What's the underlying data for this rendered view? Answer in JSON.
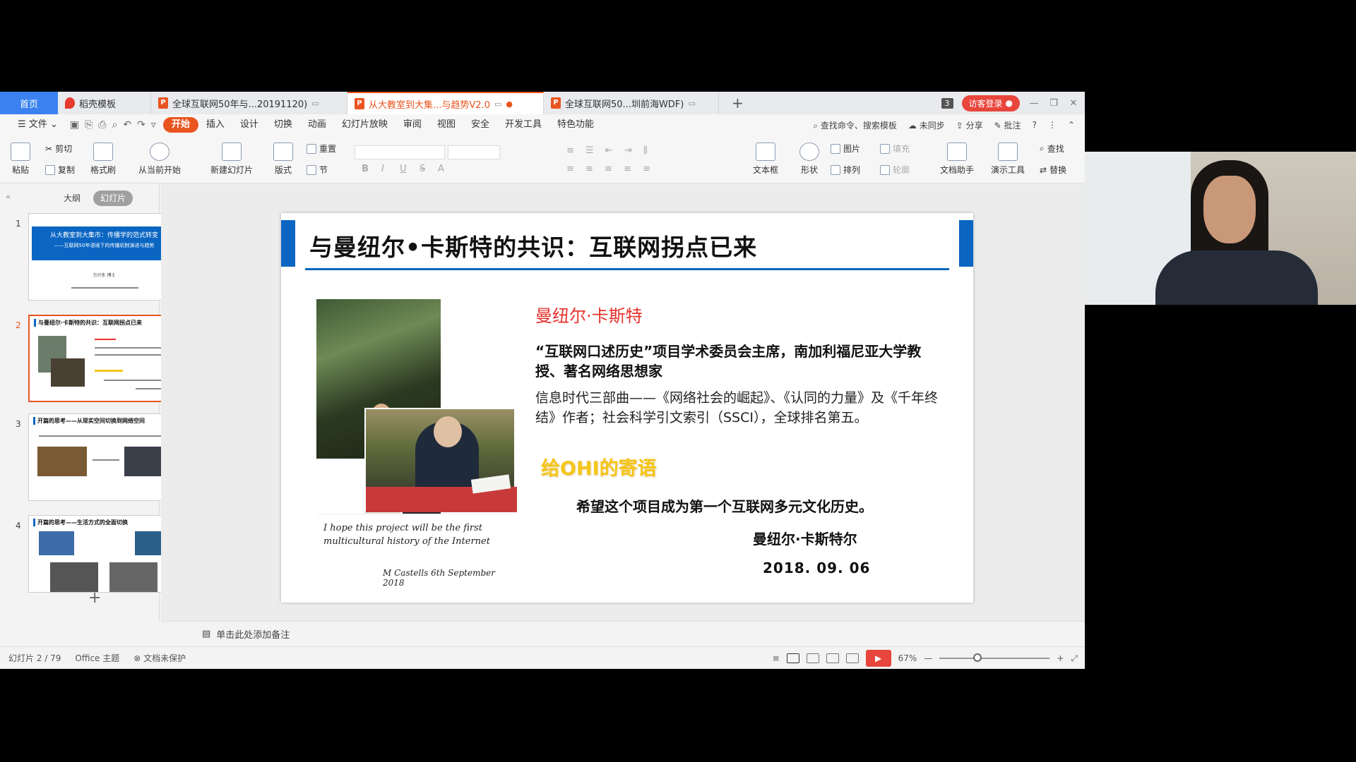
{
  "tabs": {
    "home": "首页",
    "items": [
      {
        "label": "稻壳模板",
        "icon": "docer-icon"
      },
      {
        "label": "全球互联网50年与...20191120)",
        "icon": "ppt-icon"
      },
      {
        "label": "从大教室到大集...与趋势V2.0",
        "icon": "ppt-icon"
      },
      {
        "label": "全球互联网50...圳前海WDF)",
        "icon": "ppt-icon"
      }
    ],
    "window_badge": "3",
    "login": "访客登录"
  },
  "menu": {
    "file": "文件",
    "items": [
      "开始",
      "插入",
      "设计",
      "切换",
      "动画",
      "幻灯片放映",
      "审阅",
      "视图",
      "安全",
      "开发工具",
      "特色功能"
    ],
    "search": "查找命令、搜索模板",
    "sync": "未同步",
    "share": "分享",
    "comment": "批注"
  },
  "ribbon": {
    "paste": "粘贴",
    "cut": "剪切",
    "copy": "复制",
    "format_painter": "格式刷",
    "from_current": "从当前开始",
    "new_slide": "新建幻灯片",
    "layout": "版式",
    "reset": "重置",
    "section": "节",
    "textbox": "文本框",
    "shape": "形状",
    "arrange": "排列",
    "picture": "图片",
    "fill": "填充",
    "outline": "轮廓",
    "doc_helper": "文档助手",
    "presenter_tools": "演示工具",
    "find": "查找",
    "replace": "替换"
  },
  "leftpane": {
    "outline_tab": "大纲",
    "slides_tab": "幻灯片",
    "thumbs": [
      {
        "num": "1",
        "title": "从大教室到大集市：传播学的范式转变",
        "subtitle": "——互联网50年语境下的传播机制演进与趋势",
        "author": "方兴东 博士"
      },
      {
        "num": "2",
        "title": "与曼纽尔·卡斯特的共识：互联网拐点已来"
      },
      {
        "num": "3",
        "title": "开篇的思考——从现实空间切换到网络空间"
      },
      {
        "num": "4",
        "title": "开篇的思考——生活方式的全面切换"
      }
    ]
  },
  "slide": {
    "title": "与曼纽尔•卡斯特的共识：互联网拐点已来",
    "name": "曼纽尔·卡斯特",
    "role": "“互联网口述历史”项目学术委员会主席，南加利福尼亚大学教授、著名网络思想家",
    "desc": "信息时代三部曲——《网络社会的崛起》、《认同的力量》及《千年终结》作者；社会科学引文索引（SSCI），全球排名第五。",
    "message_title": "给OHI的寄语",
    "message": "希望这个项目成为第一个互联网多元文化历史。",
    "author": "曼纽尔·卡斯特尔",
    "date": "2018. 09. 06",
    "handwritten_note": "I hope this project will be the first multicultural history of the Internet",
    "handwritten_sig": "M Castells   6th September 2018"
  },
  "notes_placeholder": "单击此处添加备注",
  "status": {
    "slide_count": "幻灯片 2 / 79",
    "theme": "Office 主题",
    "protection": "文档未保护",
    "zoom": "67%"
  },
  "colors": {
    "accent_orange": "#e9541f",
    "slide_blue": "#0a66c2",
    "name_red": "#e8322e",
    "message_yellow": "#f5c518"
  }
}
